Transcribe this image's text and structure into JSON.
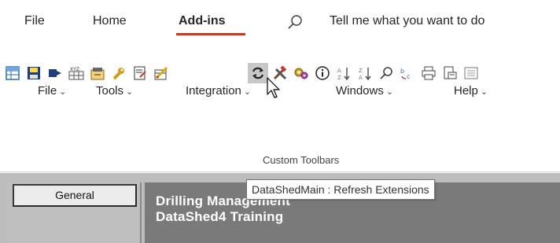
{
  "tabs": [
    {
      "label": "File"
    },
    {
      "label": "Home"
    },
    {
      "label": "Add-ins",
      "active": true
    }
  ],
  "tell_me": {
    "label": "Tell me what you want to do"
  },
  "toolbar": {
    "icons": [
      "grid-table-icon",
      "save-disk-icon",
      "export-arrow-icon",
      "xyz-table-icon",
      "book-folder-icon",
      "wrench-icon",
      "notepad-edit-icon",
      "table-pencil-icon",
      "refresh-arrows-icon",
      "tools-hammer-icon",
      "gears-icon",
      "info-icon",
      "sort-ascending-icon",
      "sort-descending-icon",
      "find-icon",
      "replace-icon",
      "print-icon",
      "print-preview-icon",
      "properties-icon"
    ],
    "hover_index": 8
  },
  "menus": [
    {
      "label": "File"
    },
    {
      "label": "Tools"
    },
    {
      "label": "Integration"
    },
    {
      "label": "Windows"
    },
    {
      "label": "Help"
    }
  ],
  "group_label": "Custom Toolbars",
  "tooltip": "DataShedMain : Refresh Extensions",
  "app": {
    "general_button": "General",
    "title_line1": "Drilling Management",
    "title_line2": "DataShed4 Training"
  },
  "colors": {
    "accent_underline": "#c43e1c",
    "dark_panel": "#7a7a7a",
    "lower_background": "#bdbdbd"
  }
}
